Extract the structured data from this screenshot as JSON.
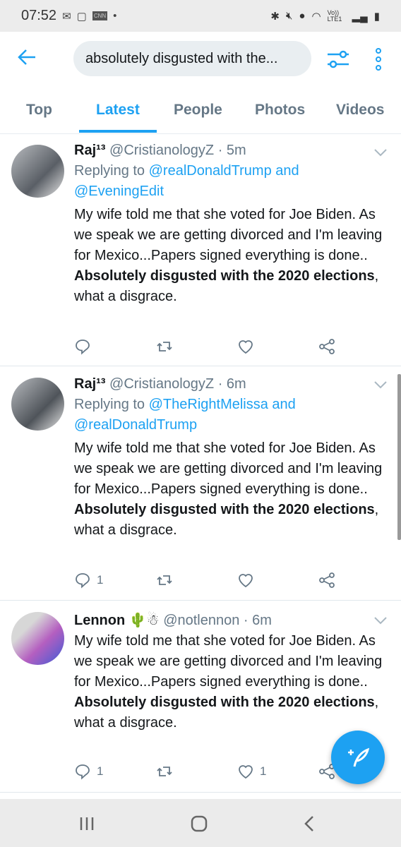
{
  "status_bar": {
    "time": "07:52",
    "left_icons": [
      "gmail-icon",
      "screenshot-icon",
      "cnn-icon",
      "dot-icon"
    ],
    "right_icons": [
      "bluetooth-icon",
      "mute-icon",
      "location-icon",
      "wifi-icon",
      "volte-lte-icon",
      "signal-icon",
      "battery-icon"
    ],
    "lte_label": "Vo)) LTE1"
  },
  "header": {
    "search_value": "absolutely disgusted with the...",
    "accent": "#1da1f2"
  },
  "tabs": [
    {
      "label": "Top"
    },
    {
      "label": "Latest",
      "active": true
    },
    {
      "label": "People"
    },
    {
      "label": "Photos"
    },
    {
      "label": "Videos"
    }
  ],
  "tweets": [
    {
      "name": "Raj¹³",
      "handle": "@CristianologyZ",
      "time": "· 5m",
      "replying_prefix": "Replying to ",
      "reply_to_1": "@realDonaldTrump",
      "reply_and": " and",
      "reply_to_2": "@EveningEdit",
      "body": "My wife told me that she voted for Joe Biden. As we speak we are getting divorced and I'm leaving for Mexico...Papers signed everything is done..",
      "bold": "Absolutely disgusted with the 2020 elections",
      "tail": ", what a disgrace.",
      "replies": "",
      "likes": ""
    },
    {
      "name": "Raj¹³",
      "handle": "@CristianologyZ",
      "time": "· 6m",
      "replying_prefix": "Replying to ",
      "reply_to_1": "@TheRightMelissa",
      "reply_and": " and",
      "reply_to_2": "@realDonaldTrump",
      "body": "My wife told me that she voted for Joe Biden. As we speak we are getting divorced and I'm leaving for Mexico...Papers signed everything is done..",
      "bold": "Absolutely disgusted with the 2020 elections",
      "tail": ", what a disgrace.",
      "replies": "1",
      "likes": ""
    },
    {
      "name": "Lennon",
      "emoji": "🌵☃",
      "handle": "@notlennon",
      "time": "· 6m",
      "body": "My wife told me that she voted for Joe Biden. As we speak we are getting divorced and I'm leaving for Mexico...Papers signed everything is done..",
      "bold": "Absolutely disgusted with the 2020 elections",
      "tail": ", what a disgrace.",
      "replies": "1",
      "likes": "1"
    }
  ],
  "fab": {
    "icon": "compose-tweet-icon"
  },
  "nav_bar": {
    "icons": [
      "recents-icon",
      "home-icon",
      "back-icon"
    ]
  }
}
